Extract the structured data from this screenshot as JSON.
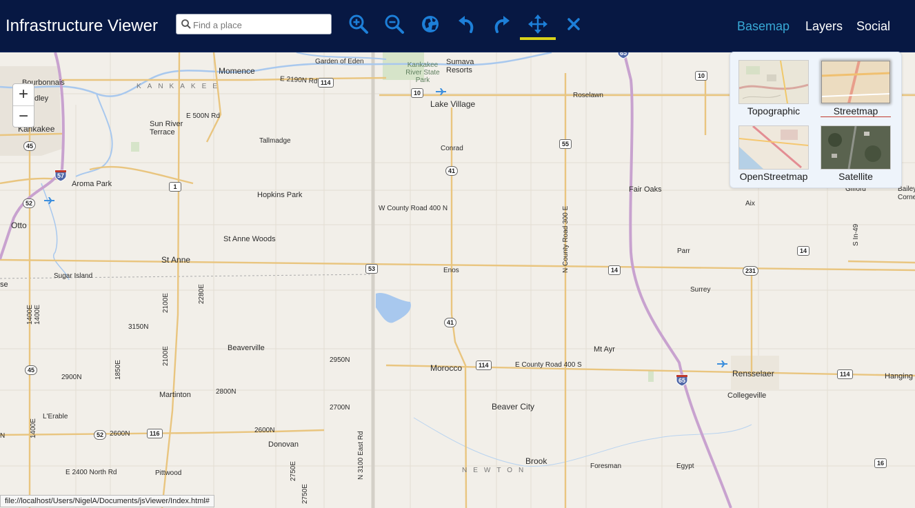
{
  "app": {
    "title": "Infrastructure Viewer"
  },
  "search": {
    "placeholder": "Find a place",
    "value": ""
  },
  "toolbar": {
    "icons": [
      "zoom-in-icon",
      "zoom-out-icon",
      "globe-icon",
      "undo-icon",
      "redo-icon",
      "pan-icon",
      "close-icon"
    ],
    "active_tool": "pan"
  },
  "nav": {
    "basemap": "Basemap",
    "layers": "Layers",
    "social": "Social",
    "active": "Basemap"
  },
  "zoom_control": {
    "plus": "+",
    "minus": "−"
  },
  "basemaps": {
    "items": [
      {
        "label": "Topographic",
        "selected": false
      },
      {
        "label": "Streetmap",
        "selected": true
      },
      {
        "label": "OpenStreetmap",
        "selected": false
      },
      {
        "label": "Satellite",
        "selected": false
      }
    ]
  },
  "map": {
    "places": {
      "momence": "Momence",
      "garden_of_eden": "Garden of Eden",
      "sumava_resorts": "Sumava Resorts",
      "bourbonnais": "Bourbonnais",
      "bradley": "dley",
      "kankakee": "Kankakee",
      "sun_river_terrace": "Sun River Terrace",
      "tallmadge": "Tallmadge",
      "aroma_park": "Aroma Park",
      "hopkins_park": "Hopkins Park",
      "otto": "Otto",
      "st_anne_woods": "St Anne Woods",
      "st_anne": "St Anne",
      "sugar_island": "Sugar Island",
      "se": "se",
      "lake_village": "Lake Village",
      "roselawn": "Roselawn",
      "conrad": "Conrad",
      "fair_oaks": "Fair Oaks",
      "gifford": "Gifford",
      "bailey": "Bailey",
      "corne": "Corne",
      "aix": "Aix",
      "parr": "Parr",
      "surrey": "Surrey",
      "enos": "Enos",
      "beaverville": "Beaverville",
      "mt_ayr": "Mt Ayr",
      "morocco": "Morocco",
      "rensselaer": "Rensselaer",
      "hanging": "Hanging",
      "collegeville": "Collegeville",
      "martinton": "Martinton",
      "beaver_city": "Beaver City",
      "lerable": "L'Erable",
      "donovan": "Donovan",
      "pittwood": "Pittwood",
      "brook": "Brook",
      "foresman": "Foresman",
      "egypt": "Egypt",
      "kankakee_county": "KANKAKEE",
      "newton_county": "NEWTON",
      "kankakee_river_state_park": "Kankakee River State Park"
    },
    "roads": {
      "e2190n": "E 2190N Rd",
      "e500n": "E 500N Rd",
      "w_county_road_400n": "W County Road 400 N",
      "n_county_road_300e": "N County Road 300 E",
      "e_county_road_400s": "E County Road 400 S",
      "r3150n": "3150N",
      "r2950n": "2950N",
      "r2900n": "2900N",
      "r2800n": "2800N",
      "r2700n": "2700N",
      "r2600n_a": "2600N",
      "r2600n_b": "2600N",
      "e2400north": "E 2400 North Rd",
      "r1400e_a": "1400E",
      "r1400e_b": "1400E",
      "r1400e_c": "1400E",
      "r1850e": "1850E",
      "r2100e_a": "2100E",
      "r2100e_b": "2100E",
      "r2280e": "2280E",
      "r2750e_a": "2750E",
      "r2750e_b": "2750E",
      "n3100east": "N 3100 East Rd",
      "s_in49": "S In-49",
      "n_a": "N"
    },
    "shields": {
      "s114a": "114",
      "s10a": "10",
      "s10b": "10",
      "s55": "55",
      "s41a": "41",
      "s41b": "41",
      "s1": "1",
      "s45a": "45",
      "s45b": "45",
      "s52a": "52",
      "s52b": "52",
      "s53": "53",
      "s14a": "14",
      "s14b": "14",
      "s231": "231",
      "s114b": "114",
      "s114c": "114",
      "s116": "116",
      "s16": "16",
      "i57": "57",
      "i65": "65",
      "i65top": "65"
    }
  },
  "status_bar": {
    "url": "file://localhost/Users/NigelA/Documents/jsViewer/Index.html#"
  }
}
